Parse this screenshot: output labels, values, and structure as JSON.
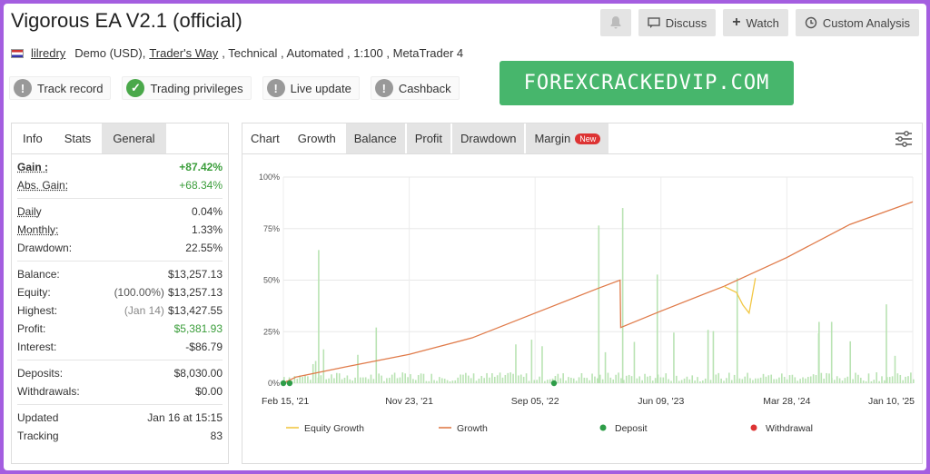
{
  "header": {
    "title": "Vigorous EA V2.1 (official)",
    "actions": {
      "discuss": "Discuss",
      "watch": "Watch",
      "custom": "Custom Analysis"
    }
  },
  "meta": {
    "user": "lilredry",
    "account": "Demo (USD),",
    "broker": "Trader's Way",
    "rest": ", Technical , Automated , 1:100 , MetaTrader 4"
  },
  "badges": [
    {
      "label": "Track record",
      "icon": "exclamation-icon"
    },
    {
      "label": "Trading privileges",
      "icon": "check-icon"
    },
    {
      "label": "Live update",
      "icon": "exclamation-icon"
    },
    {
      "label": "Cashback",
      "icon": "exclamation-icon"
    }
  ],
  "promo": "FOREXCRACKEDVIP.COM",
  "left_tabs": {
    "info": "Info",
    "stats": "Stats",
    "general": "General"
  },
  "stats": {
    "gain": {
      "label": "Gain :",
      "value": "+87.42%"
    },
    "abs_gain": {
      "label": "Abs. Gain:",
      "value": "+68.34%"
    },
    "daily": {
      "label": "Daily",
      "value": "0.04%"
    },
    "monthly": {
      "label": "Monthly:",
      "value": "1.33%"
    },
    "drawdown": {
      "label": "Drawdown:",
      "value": "22.55%"
    },
    "balance": {
      "label": "Balance:",
      "value": "$13,257.13"
    },
    "equity": {
      "label": "Equity:",
      "sub": "(100.00%)",
      "value": "$13,257.13"
    },
    "highest": {
      "label": "Highest:",
      "sub": "(Jan 14)",
      "value": "$13,427.55"
    },
    "profit": {
      "label": "Profit:",
      "value": "$5,381.93"
    },
    "interest": {
      "label": "Interest:",
      "value": "-$86.79"
    },
    "deposits": {
      "label": "Deposits:",
      "value": "$8,030.00"
    },
    "withdrawals": {
      "label": "Withdrawals:",
      "value": "$0.00"
    },
    "updated": {
      "label": "Updated",
      "value": "Jan 16 at 15:15"
    },
    "tracking": {
      "label": "Tracking",
      "value": "83"
    }
  },
  "right_tabs": {
    "chart": "Chart",
    "growth": "Growth",
    "balance": "Balance",
    "profit": "Profit",
    "drawdown": "Drawdown",
    "margin": "Margin",
    "new": "New"
  },
  "colors": {
    "growth": "#e07b4a",
    "equity": "#f2c744",
    "deposit": "#2e9d48",
    "withdrawal": "#d33",
    "bars": "#b9e3b3"
  },
  "chart_data": {
    "type": "line",
    "y_ticks": [
      "100%",
      "75%",
      "50%",
      "25%",
      "0%"
    ],
    "x_ticks": [
      "Feb 15, '21",
      "Nov 23, '21",
      "Sep 05, '22",
      "Jun 09, '23",
      "Mar 28, '24",
      "Jan 10, '25"
    ],
    "ylim": [
      0,
      100
    ],
    "legend": [
      "Equity Growth",
      "Growth",
      "Deposit",
      "Withdrawal"
    ],
    "series": [
      {
        "name": "Growth",
        "x": [
          0,
          0.02,
          0.1,
          0.2,
          0.3,
          0.4,
          0.5,
          0.535,
          0.536,
          0.6,
          0.7,
          0.8,
          0.9,
          1.0
        ],
        "values": [
          0,
          3,
          8,
          14,
          22,
          34,
          46,
          50,
          27,
          35,
          47,
          61,
          77,
          88
        ]
      },
      {
        "name": "Equity Growth",
        "x": [
          0.7,
          0.72,
          0.73,
          0.74,
          0.75
        ],
        "values": [
          47,
          44,
          38,
          34,
          51
        ]
      }
    ],
    "deposits_x": [
      0.0,
      0.01,
      0.43
    ]
  }
}
